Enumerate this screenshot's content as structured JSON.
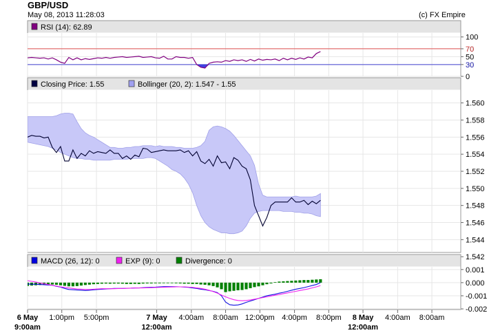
{
  "header": {
    "title": "GBP/USD",
    "timestamp": "May 08, 2013 11:28:03",
    "credit": "(c) FX Empire"
  },
  "chart_data": [
    {
      "type": "line",
      "panel": "rsi",
      "legend": [
        {
          "label": "RSI (14): 62.89",
          "color": "#800080"
        }
      ],
      "ylim": [
        0,
        110
      ],
      "yticks": [
        "100",
        "70",
        "50",
        "30",
        "0"
      ],
      "ytick_values": [
        100,
        70,
        50,
        30,
        0
      ],
      "reference_lines": [
        {
          "value": 70,
          "label": "70",
          "color": "#e05050"
        },
        {
          "value": 30,
          "label": "30",
          "color": "#4040d0"
        }
      ],
      "series": [
        {
          "values": [
            47,
            48,
            47,
            46,
            47,
            44,
            47,
            42,
            36,
            33,
            48,
            42,
            47,
            42,
            45,
            43,
            45,
            47,
            46,
            48,
            46,
            48,
            49,
            50,
            48,
            49,
            50,
            51,
            48,
            49,
            50,
            47,
            46,
            51,
            44,
            44,
            50,
            48,
            48,
            46,
            48,
            30,
            23,
            21,
            33,
            36,
            37,
            36,
            40,
            38,
            42,
            40,
            42,
            38,
            43,
            39,
            44,
            41,
            43,
            42,
            44,
            40,
            46,
            42,
            46,
            43,
            47,
            44,
            49,
            47,
            58,
            63
          ]
        }
      ]
    },
    {
      "type": "line",
      "panel": "price",
      "legend": [
        {
          "label": "Closing Price: 1.55",
          "color": "#000040"
        },
        {
          "label": "Bollinger (20, 2): 1.547 - 1.55",
          "color": "#a0a0f0"
        }
      ],
      "ylim": [
        1.5425,
        1.5615
      ],
      "yticks": [
        "1.560",
        "1.558",
        "1.556",
        "1.554",
        "1.552",
        "1.550",
        "1.548",
        "1.546",
        "1.544",
        "1.542"
      ],
      "ytick_values": [
        1.56,
        1.558,
        1.556,
        1.554,
        1.552,
        1.55,
        1.548,
        1.546,
        1.544,
        1.542
      ],
      "band_upper": [
        1.5584,
        1.5584,
        1.5584,
        1.5584,
        1.5584,
        1.5584,
        1.5584,
        1.5585,
        1.5587,
        1.5588,
        1.5588,
        1.5587,
        1.5578,
        1.557,
        1.5565,
        1.5562,
        1.556,
        1.5557,
        1.5554,
        1.5551,
        1.5548,
        1.5548,
        1.5547,
        1.5547,
        1.5548,
        1.5548,
        1.5549,
        1.5549,
        1.555,
        1.555,
        1.555,
        1.5549,
        1.555,
        1.5549,
        1.5549,
        1.5549,
        1.5548,
        1.5548,
        1.5547,
        1.5547,
        1.5547,
        1.5548,
        1.555,
        1.5555,
        1.5568,
        1.5572,
        1.5573,
        1.5572,
        1.557,
        1.5567,
        1.5562,
        1.5556,
        1.555,
        1.5544,
        1.5538,
        1.5527,
        1.5505,
        1.5492,
        1.549,
        1.549,
        1.549,
        1.549,
        1.549,
        1.549,
        1.549,
        1.5491,
        1.549,
        1.549,
        1.549,
        1.549,
        1.5491,
        1.5494
      ],
      "band_lower": [
        1.5554,
        1.5553,
        1.5552,
        1.5551,
        1.555,
        1.5549,
        1.5547,
        1.5545,
        1.5542,
        1.554,
        1.5538,
        1.5536,
        1.5535,
        1.5535,
        1.5534,
        1.5534,
        1.5533,
        1.5533,
        1.5533,
        1.5533,
        1.5533,
        1.5534,
        1.5534,
        1.5534,
        1.5534,
        1.5535,
        1.5535,
        1.5535,
        1.5535,
        1.5536,
        1.5536,
        1.5535,
        1.5532,
        1.5529,
        1.5526,
        1.5522,
        1.552,
        1.5517,
        1.5512,
        1.5505,
        1.5495,
        1.548,
        1.5468,
        1.546,
        1.5455,
        1.5452,
        1.545,
        1.5448,
        1.5448,
        1.5447,
        1.5447,
        1.5448,
        1.545,
        1.5456,
        1.5465,
        1.5471,
        1.5473,
        1.5474,
        1.5474,
        1.5474,
        1.5474,
        1.5474,
        1.5473,
        1.5473,
        1.5473,
        1.5472,
        1.5472,
        1.5471,
        1.5471,
        1.547,
        1.5468,
        1.5467
      ],
      "series": [
        {
          "values": [
            1.556,
            1.5562,
            1.5561,
            1.5561,
            1.5559,
            1.556,
            1.5548,
            1.5542,
            1.5549,
            1.5532,
            1.5532,
            1.5545,
            1.5535,
            1.5541,
            1.5538,
            1.5544,
            1.5541,
            1.5543,
            1.5542,
            1.5541,
            1.5545,
            1.5541,
            1.5541,
            1.5535,
            1.5538,
            1.5534,
            1.5539,
            1.5537,
            1.5547,
            1.5546,
            1.5542,
            1.5543,
            1.5544,
            1.5545,
            1.5544,
            1.5544,
            1.5544,
            1.5545,
            1.5542,
            1.5544,
            1.5538,
            1.5543,
            1.5532,
            1.5529,
            1.5534,
            1.5526,
            1.5538,
            1.553,
            1.5531,
            1.5523,
            1.5536,
            1.5533,
            1.5526,
            1.5523,
            1.551,
            1.548,
            1.5468,
            1.5456,
            1.5466,
            1.548,
            1.5484,
            1.5484,
            1.5484,
            1.5484,
            1.5489,
            1.5484,
            1.5484,
            1.5486,
            1.5481,
            1.5485,
            1.5482,
            1.5486
          ]
        }
      ]
    },
    {
      "type": "bar",
      "panel": "macd",
      "legend": [
        {
          "label": "MACD (26, 12): 0",
          "color": "#0000e0"
        },
        {
          "label": "EXP (9): 0",
          "color": "#f020f0"
        },
        {
          "label": "Divergence: 0",
          "color": "#008000"
        }
      ],
      "ylim": [
        -0.00205,
        0.0012
      ],
      "yticks": [
        "0.001",
        "0.000",
        "-0.001",
        "-0.002"
      ],
      "ytick_values": [
        0.001,
        0,
        -0.001,
        -0.002
      ],
      "divergence": [
        -0.00025,
        -0.00022,
        -0.0002,
        -0.00018,
        -0.00016,
        -0.00016,
        -0.00014,
        -0.00016,
        -0.0002,
        -0.00024,
        -0.00028,
        -0.00028,
        -0.00026,
        -0.00022,
        -0.00018,
        -0.00015,
        -0.00012,
        -0.0001,
        -8e-05,
        -7e-05,
        -8e-05,
        -7e-05,
        -7e-05,
        -8e-05,
        -0.0001,
        -0.0001,
        -9e-05,
        -0.0001,
        -7e-05,
        -6e-05,
        -6e-05,
        -5e-05,
        -5e-05,
        -4e-05,
        -4e-05,
        -4e-05,
        -5e-05,
        -6e-05,
        -8e-05,
        -8e-05,
        -0.0001,
        -0.0001,
        -0.00014,
        -0.00016,
        -0.0002,
        -0.00026,
        -0.00036,
        -0.0005,
        -0.00072,
        -0.00066,
        -0.00062,
        -0.00058,
        -0.00056,
        -0.0005,
        -0.00042,
        -0.00034,
        -0.00028,
        -0.0002,
        -0.00012,
        -6e-05,
        4e-05,
        8e-05,
        0.0001,
        0.00012,
        0.00014,
        0.00016,
        0.00018,
        0.0002,
        0.0002,
        0.00022,
        0.00024,
        0.00026
      ],
      "series": [
        {
          "name": "MACD",
          "values": [
            -0.0001,
            -0.00012,
            -0.00012,
            -0.00014,
            -0.00016,
            -0.00018,
            -0.0002,
            -0.00028,
            -0.00034,
            -0.00044,
            -0.00052,
            -0.00054,
            -0.00056,
            -0.00058,
            -0.0006,
            -0.00058,
            -0.00055,
            -0.00052,
            -0.0005,
            -0.00048,
            -0.00046,
            -0.00044,
            -0.00044,
            -0.00044,
            -0.00043,
            -0.00042,
            -0.0004,
            -0.0004,
            -0.00038,
            -0.00036,
            -0.00035,
            -0.00034,
            -0.00032,
            -0.0003,
            -0.0003,
            -0.0003,
            -0.00031,
            -0.00032,
            -0.00034,
            -0.00036,
            -0.0004,
            -0.00044,
            -0.0005,
            -0.00054,
            -0.0006,
            -0.00066,
            -0.00076,
            -0.001,
            -0.00148,
            -0.00168,
            -0.00172,
            -0.0017,
            -0.00162,
            -0.0015,
            -0.0014,
            -0.0013,
            -0.0012,
            -0.0011,
            -0.001,
            -0.00094,
            -0.00088,
            -0.0008,
            -0.00074,
            -0.00066,
            -0.00058,
            -0.0005,
            -0.00044,
            -0.00038,
            -0.0003,
            -0.00022,
            -0.00014,
            0.0
          ]
        },
        {
          "name": "EXP",
          "values": [
            0.00015,
            0.0001,
            5e-05,
            -2e-05,
            -8e-05,
            -0.00014,
            -0.0002,
            -0.00026,
            -0.00032,
            -0.00036,
            -0.0004,
            -0.00044,
            -0.00048,
            -0.0005,
            -0.00052,
            -0.00052,
            -0.0005,
            -0.00048,
            -0.00046,
            -0.00046,
            -0.00046,
            -0.00046,
            -0.00045,
            -0.00044,
            -0.00043,
            -0.00042,
            -0.00041,
            -0.0004,
            -0.0004,
            -0.00039,
            -0.00038,
            -0.00037,
            -0.00036,
            -0.00035,
            -0.00034,
            -0.00033,
            -0.00032,
            -0.00032,
            -0.00032,
            -0.00034,
            -0.00036,
            -0.0004,
            -0.00044,
            -0.0005,
            -0.00058,
            -0.00068,
            -0.0008,
            -0.00094,
            -0.00108,
            -0.0012,
            -0.0013,
            -0.00136,
            -0.00138,
            -0.00136,
            -0.00132,
            -0.00126,
            -0.0012,
            -0.00114,
            -0.00108,
            -0.00102,
            -0.00096,
            -0.0009,
            -0.00084,
            -0.00078,
            -0.00072,
            -0.00066,
            -0.0006,
            -0.00054,
            -0.00048,
            -0.0004,
            -0.00032,
            -0.00022
          ]
        }
      ]
    }
  ],
  "x_axis": {
    "labels": [
      {
        "line1": "6 May",
        "line2": "9:00am",
        "bold": true,
        "index": 0
      },
      {
        "line1": "1:00pm",
        "line2": "",
        "bold": false,
        "index": 8.3
      },
      {
        "line1": "5:00pm",
        "line2": "",
        "bold": false,
        "index": 16.7
      },
      {
        "line1": "7 May",
        "line2": "12:00am",
        "bold": true,
        "index": 31.3
      },
      {
        "line1": "4:00am",
        "line2": "",
        "bold": false,
        "index": 39.7
      },
      {
        "line1": "8:00am",
        "line2": "",
        "bold": false,
        "index": 48
      },
      {
        "line1": "12:00pm",
        "line2": "",
        "bold": false,
        "index": 56.3
      },
      {
        "line1": "4:00pm",
        "line2": "",
        "bold": false,
        "index": 64.7
      },
      {
        "line1": "8:00pm",
        "line2": "",
        "bold": false,
        "index": 73
      },
      {
        "line1": "8 May",
        "line2": "12:00am",
        "bold": true,
        "index": 81.3
      },
      {
        "line1": "4:00am",
        "line2": "",
        "bold": false,
        "index": 89.7
      },
      {
        "line1": "8:00am",
        "line2": "",
        "bold": false,
        "index": 98
      }
    ],
    "index_range": [
      0,
      105
    ]
  }
}
